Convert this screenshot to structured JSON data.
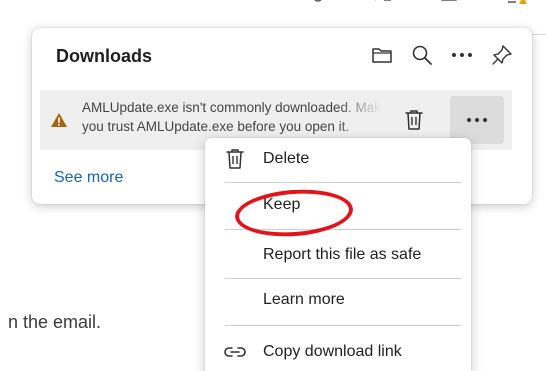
{
  "downloads": {
    "title": "Downloads",
    "item": {
      "line1": "AMLUpdate.exe isn't commonly downloaded. Make sure",
      "line2": "you trust AMLUpdate.exe before you open it."
    },
    "see_more": "See more"
  },
  "context_menu": {
    "items": [
      {
        "label": "Delete",
        "icon": "trash-icon"
      },
      {
        "label": "Keep",
        "icon": ""
      },
      {
        "label": "Report this file as safe",
        "icon": ""
      },
      {
        "label": "Learn more",
        "icon": ""
      },
      {
        "label": "Copy download link",
        "icon": "link-icon"
      }
    ]
  },
  "background": {
    "text": "n the email."
  },
  "colors": {
    "link": "#1a63b5",
    "warning": "#a8640a",
    "annotation": "#e3121b",
    "item_bg": "#efefef"
  }
}
